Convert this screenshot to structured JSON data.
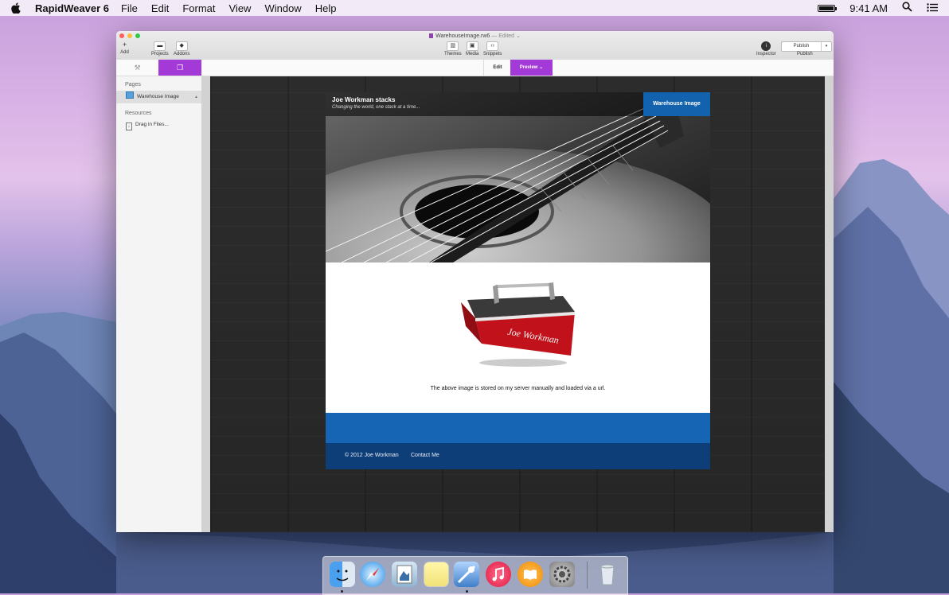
{
  "menubar": {
    "app_name": "RapidWeaver 6",
    "menus": [
      "File",
      "Edit",
      "Format",
      "View",
      "Window",
      "Help"
    ],
    "time": "9:41 AM"
  },
  "window": {
    "doc_title": "WarehouseImage.rw6",
    "doc_status": "— Edited ⌄",
    "toolbar": {
      "add": "Add",
      "projects": "Projects",
      "addons": "Addons",
      "themes": "Themes",
      "media": "Media",
      "snippets": "Snippets",
      "inspector": "Inspector",
      "publish_button": "Publish",
      "publish_label": "Publish"
    },
    "mode": {
      "edit": "Edit",
      "preview": "Preview ⌄"
    }
  },
  "sidebar": {
    "pages_header": "Pages",
    "pages": [
      {
        "label": "Warehouse Image"
      }
    ],
    "resources_header": "Resources",
    "resources": [
      {
        "label": "Drag in Files..."
      }
    ]
  },
  "site": {
    "title": "Joe Workman stacks",
    "tagline": "Changing the world, one stack at a time...",
    "nav_item": "Warehouse Image",
    "caption": "The above image is stored on my server manually and loaded via a url.",
    "footer_copyright": "© 2012 Joe Workman",
    "footer_contact": "Contact Me",
    "toolbox_text": "Joe Workman"
  },
  "dock": {
    "apps": [
      "finder-icon",
      "safari-icon",
      "preview-icon",
      "notes-icon",
      "rapidweaver-icon",
      "itunes-icon",
      "ibooks-icon",
      "system-preferences-icon",
      "trash-icon"
    ]
  },
  "colors": {
    "accent": "#a33ad8",
    "nav_blue": "#1262ad",
    "footer_blue": "#0e3e78"
  }
}
